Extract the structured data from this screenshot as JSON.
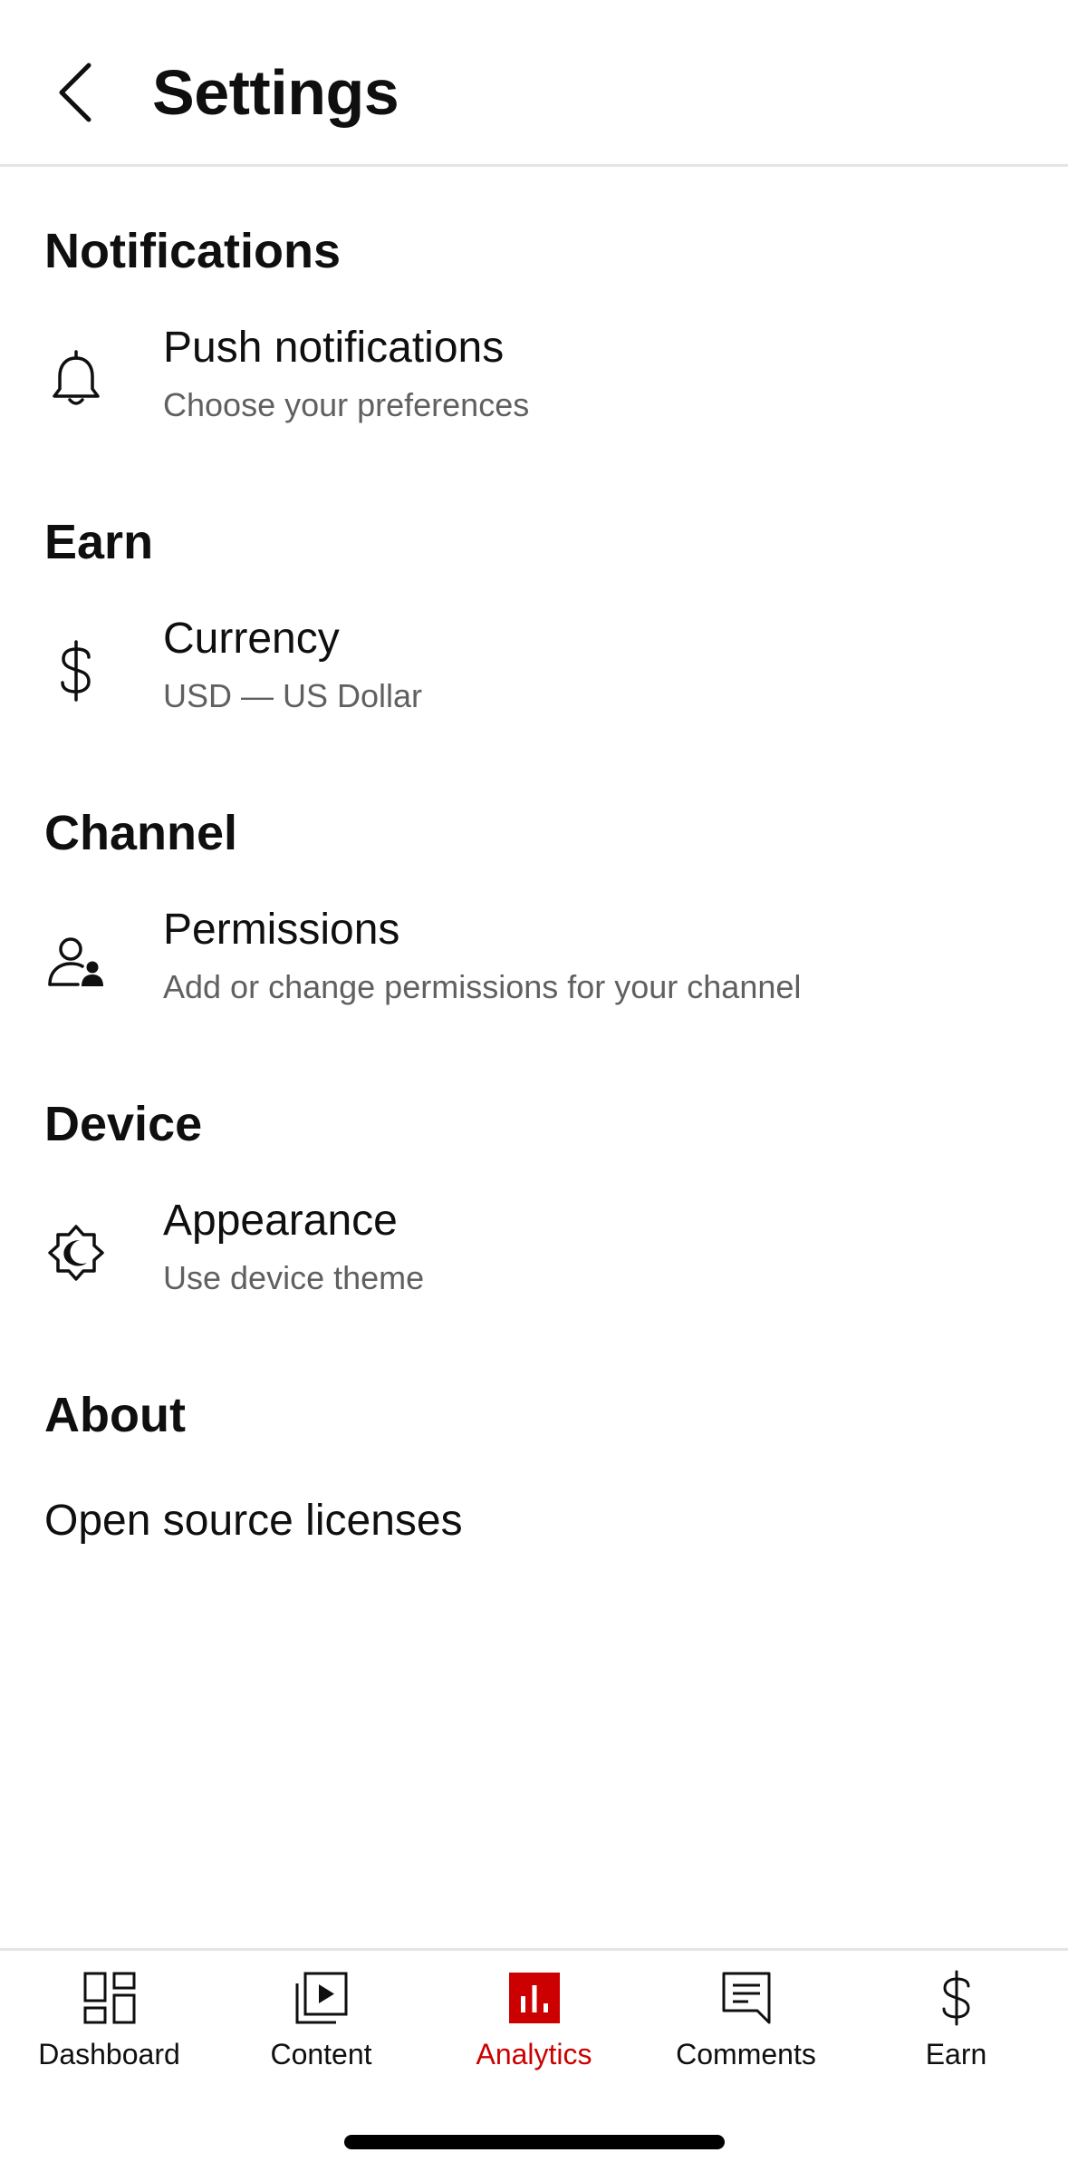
{
  "header": {
    "title": "Settings",
    "back_icon": "chevron-left-icon"
  },
  "sections": [
    {
      "title": "Notifications",
      "item": {
        "icon": "bell-icon",
        "title": "Push notifications",
        "subtitle": "Choose your preferences"
      }
    },
    {
      "title": "Earn",
      "item": {
        "icon": "dollar-icon",
        "title": "Currency",
        "subtitle": "USD — US Dollar"
      }
    },
    {
      "title": "Channel",
      "item": {
        "icon": "person-permissions-icon",
        "title": "Permissions",
        "subtitle": "Add or change permissions for your channel"
      }
    },
    {
      "title": "Device",
      "item": {
        "icon": "theme-icon",
        "title": "Appearance",
        "subtitle": "Use device theme"
      }
    },
    {
      "title": "About",
      "link": "Open source licenses"
    }
  ],
  "bottom_nav": {
    "active_color": "#cc0000",
    "items": [
      {
        "label": "Dashboard",
        "icon": "dashboard-icon",
        "active": false
      },
      {
        "label": "Content",
        "icon": "content-icon",
        "active": false
      },
      {
        "label": "Analytics",
        "icon": "analytics-icon",
        "active": true
      },
      {
        "label": "Comments",
        "icon": "comments-icon",
        "active": false
      },
      {
        "label": "Earn",
        "icon": "dollar-icon",
        "active": false
      }
    ]
  }
}
